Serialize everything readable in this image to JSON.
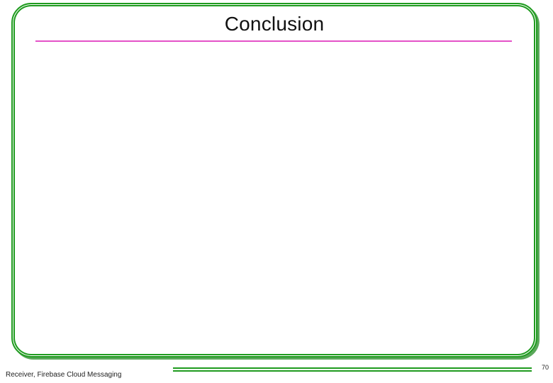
{
  "slide": {
    "title": "Conclusion",
    "footer_text": "Receiver, Firebase Cloud Messaging",
    "page_number": "70"
  },
  "colors": {
    "frame_green": "#1f9b1f",
    "underline_pink": "#e452c8",
    "text": "#111111"
  }
}
